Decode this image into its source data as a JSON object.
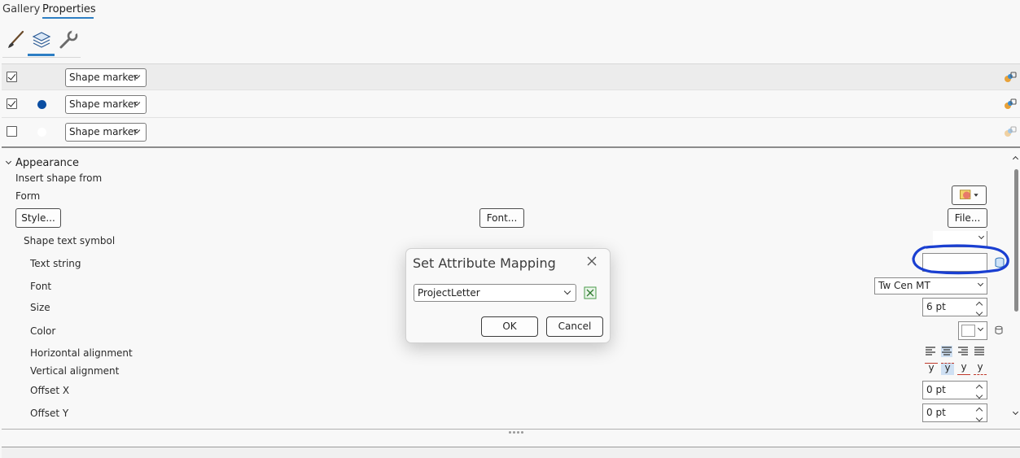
{
  "tabs": [
    {
      "label": "Gallery",
      "active": false
    },
    {
      "label": "Properties",
      "active": true
    }
  ],
  "toolbar": {
    "icons": [
      "paintbrush-icon",
      "layers-icon",
      "wrench-icon"
    ],
    "active": "layers-icon"
  },
  "layers": [
    {
      "checked": true,
      "swatch": "none",
      "type": "Shape marker",
      "selected": true
    },
    {
      "checked": true,
      "swatch": "#0b4ea2",
      "type": "Shape marker",
      "selected": false
    },
    {
      "checked": false,
      "swatch": "#ffffff",
      "type": "Shape marker",
      "selected": false
    }
  ],
  "appearance": {
    "heading": "Appearance",
    "insert_shape_from": "Insert shape from",
    "form": "Form",
    "style_button": "Style...",
    "font_button": "Font...",
    "file_button": "File...",
    "shape_text_symbol": "Shape text symbol",
    "text_string_label": "Text string",
    "text_string_value": "",
    "font_label": "Font",
    "font_value": "Tw Cen MT",
    "size_label": "Size",
    "size_value": "6 pt",
    "color_label": "Color",
    "color_value": "#ffffff",
    "halign_label": "Horizontal alignment",
    "valign_label": "Vertical alignment",
    "valign_glyph": "y",
    "offset_x_label": "Offset X",
    "offset_x_value": "0 pt",
    "offset_y_label": "Offset Y",
    "offset_y_value": "0 pt"
  },
  "dialog": {
    "title": "Set Attribute Mapping",
    "field_value": "ProjectLetter",
    "ok_label": "OK",
    "cancel_label": "Cancel"
  },
  "colors": {
    "accent": "#2d7ec4",
    "annotation_circle": "#1a3fd1"
  }
}
